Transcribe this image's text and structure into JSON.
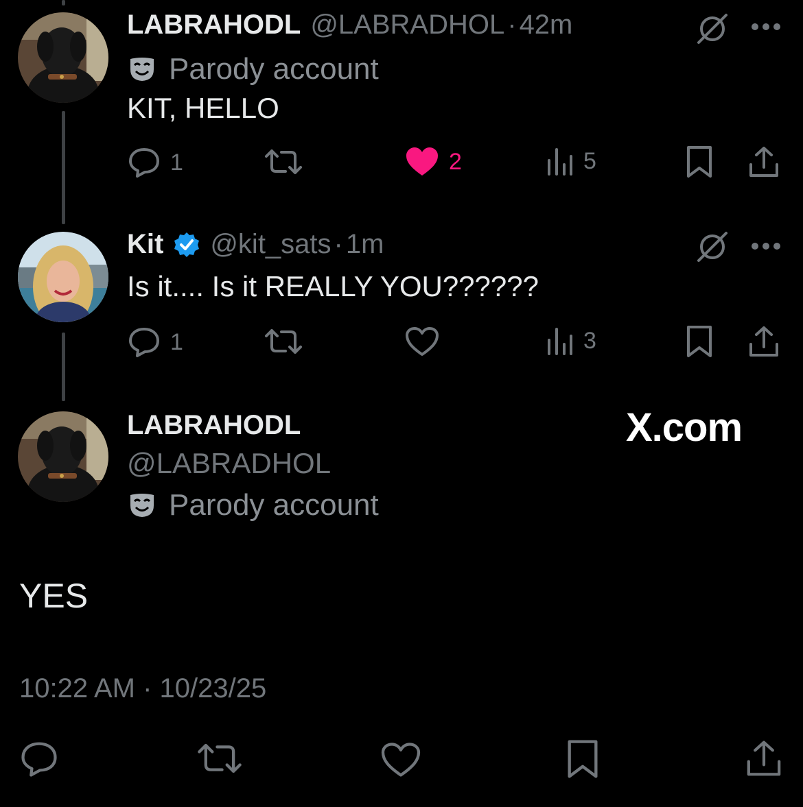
{
  "tweet1": {
    "display_name": "LABRAHODL",
    "handle": "@LABRADHOL",
    "separator": "·",
    "time": "42m",
    "parody_label": "Parody account",
    "text": "KIT, HELLO",
    "replies": "1",
    "likes": "2",
    "views": "5",
    "liked": true
  },
  "tweet2": {
    "display_name": "Kit",
    "verified": true,
    "handle": "@kit_sats",
    "separator": "·",
    "time": "1m",
    "text": "Is it.... Is it REALLY YOU??????",
    "replies": "1",
    "views": "3"
  },
  "main_tweet": {
    "display_name": "LABRAHODL",
    "handle": "@LABRADHOL",
    "parody_label": "Parody account",
    "text": "YES",
    "timestamp": "10:22 AM · 10/23/25"
  },
  "watermark": "X.com",
  "icons": [
    "reply-icon",
    "retweet-icon",
    "like-icon",
    "views-icon",
    "bookmark-icon",
    "share-icon",
    "grok-icon",
    "more-icon",
    "parody-mask-icon",
    "verified-badge-icon"
  ],
  "colors": {
    "like": "#f91880",
    "verified": "#1d9bf0",
    "muted": "#71767b",
    "text": "#e7e9ea"
  }
}
